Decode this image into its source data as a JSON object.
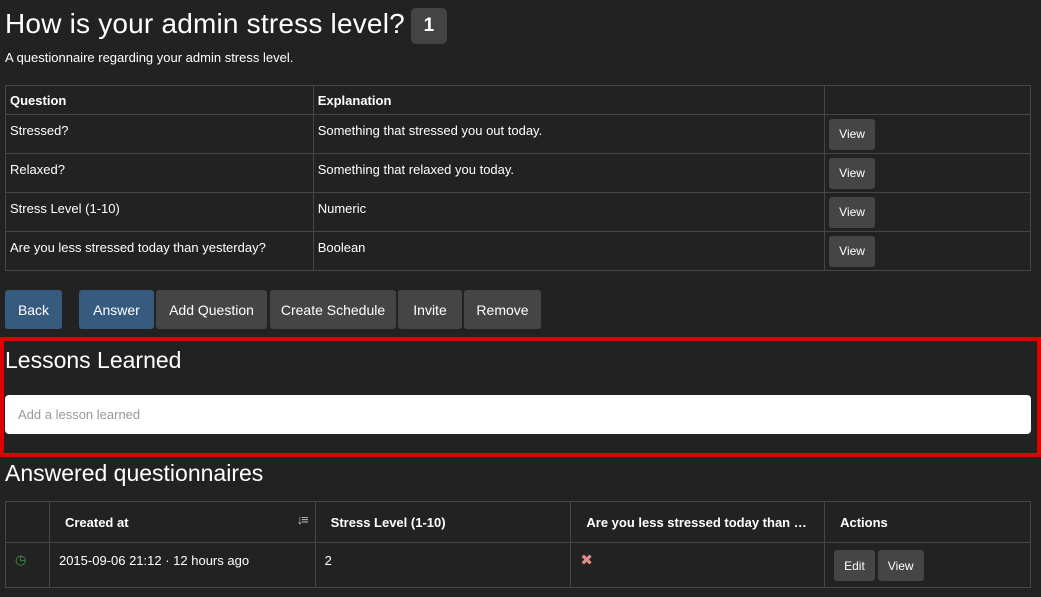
{
  "header": {
    "title": "How is your admin stress level?",
    "count": "1",
    "subtitle": "A questionnaire regarding your admin stress level."
  },
  "questions": {
    "headers": [
      "Question",
      "Explanation",
      ""
    ],
    "rows": [
      {
        "question": "Stressed?",
        "explanation": "Something that stressed you out today.",
        "action": "View"
      },
      {
        "question": "Relaxed?",
        "explanation": "Something that relaxed you today.",
        "action": "View"
      },
      {
        "question": "Stress Level (1-10)",
        "explanation": "Numeric",
        "action": "View"
      },
      {
        "question": "Are you less stressed today than yesterday?",
        "explanation": "Boolean",
        "action": "View"
      }
    ]
  },
  "toolbar": {
    "back": "Back",
    "answer": "Answer",
    "add_question": "Add Question",
    "create_schedule": "Create Schedule",
    "invite": "Invite",
    "remove": "Remove"
  },
  "lessons": {
    "title": "Lessons Learned",
    "placeholder": "Add a lesson learned",
    "value": ""
  },
  "answered": {
    "title": "Answered questionnaires",
    "headers": [
      "",
      "Created at",
      "Stress Level (1-10)",
      "Are you less stressed today than …",
      "Actions"
    ],
    "rows": [
      {
        "status_icon": "clock-icon",
        "created": "2015-09-06 21:12 · 12 hours ago",
        "stress": "2",
        "less_stressed_icon": "cross-icon",
        "edit": "Edit",
        "view": "View"
      }
    ]
  },
  "colors": {
    "background": "#222222",
    "primary": "#375a7f",
    "button": "#464545",
    "highlight": "#e00000",
    "success": "#3c9d47"
  }
}
